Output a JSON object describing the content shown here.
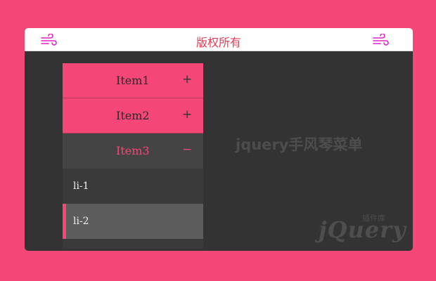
{
  "header": {
    "title": "版权所有",
    "left_icon": "wind-icon",
    "right_icon": "wind-icon"
  },
  "menu": {
    "items": [
      {
        "label": "Item1",
        "sign": "+",
        "expanded": false
      },
      {
        "label": "Item2",
        "sign": "+",
        "expanded": false
      },
      {
        "label": "Item3",
        "sign": "−",
        "expanded": true
      }
    ],
    "subitems": [
      {
        "label": "li-1",
        "selected": false
      },
      {
        "label": "li-2",
        "selected": true
      }
    ]
  },
  "main": {
    "heading": "jquery手风琴菜单"
  },
  "watermark": {
    "main": "jQuery",
    "sub": "插件库"
  },
  "colors": {
    "page_background": "#f44677",
    "panel_background": "#333333",
    "accent": "#f44677",
    "title_text": "#e53a53",
    "active_item": "#444444",
    "selected_subitem": "#5c5c5c"
  }
}
